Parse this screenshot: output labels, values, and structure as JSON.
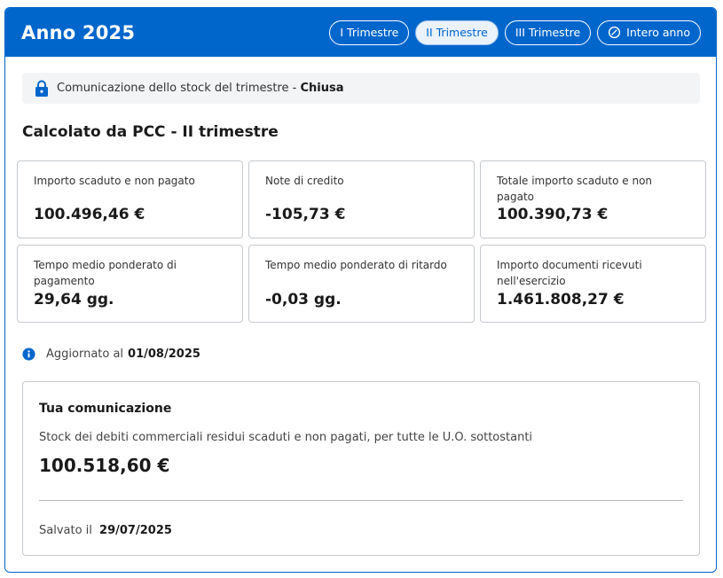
{
  "header": {
    "title": "Anno 2025",
    "tabs": [
      {
        "label": "I Trimestre",
        "active": false
      },
      {
        "label": "II Trimestre",
        "active": true
      },
      {
        "label": "III Trimestre",
        "active": false
      },
      {
        "label": "Intero anno",
        "active": false,
        "icon": "slash-circle-icon"
      }
    ]
  },
  "status": {
    "icon": "lock-icon",
    "text": "Comunicazione dello stock del trimestre -",
    "value": "Chiusa"
  },
  "section": {
    "title": "Calcolato da PCC - II trimestre"
  },
  "cards": [
    {
      "label": "Importo scaduto e non pagato",
      "value": "100.496,46 €"
    },
    {
      "label": "Note di credito",
      "value": "-105,73 €"
    },
    {
      "label": "Totale importo scaduto e non pagato",
      "value": "100.390,73 €"
    },
    {
      "label": "Tempo medio ponderato di pagamento",
      "value": "29,64 gg."
    },
    {
      "label": "Tempo medio ponderato di ritardo",
      "value": "-0,03 gg."
    },
    {
      "label": "Importo documenti ricevuti nell'esercizio",
      "value": "1.461.808,27 €"
    }
  ],
  "updated": {
    "icon": "info-icon",
    "label": "Aggiornato al",
    "date": "01/08/2025"
  },
  "communication": {
    "title": "Tua comunicazione",
    "description": "Stock dei debiti commerciali residui scaduti e non pagati, per tutte le U.O. sottostanti",
    "amount": "100.518,60 €",
    "saved_label": "Salvato il",
    "saved_date": "29/07/2025"
  },
  "colors": {
    "primary": "#0066cc",
    "border": "#c5c9ce",
    "status_bg": "#f2f4f6"
  }
}
